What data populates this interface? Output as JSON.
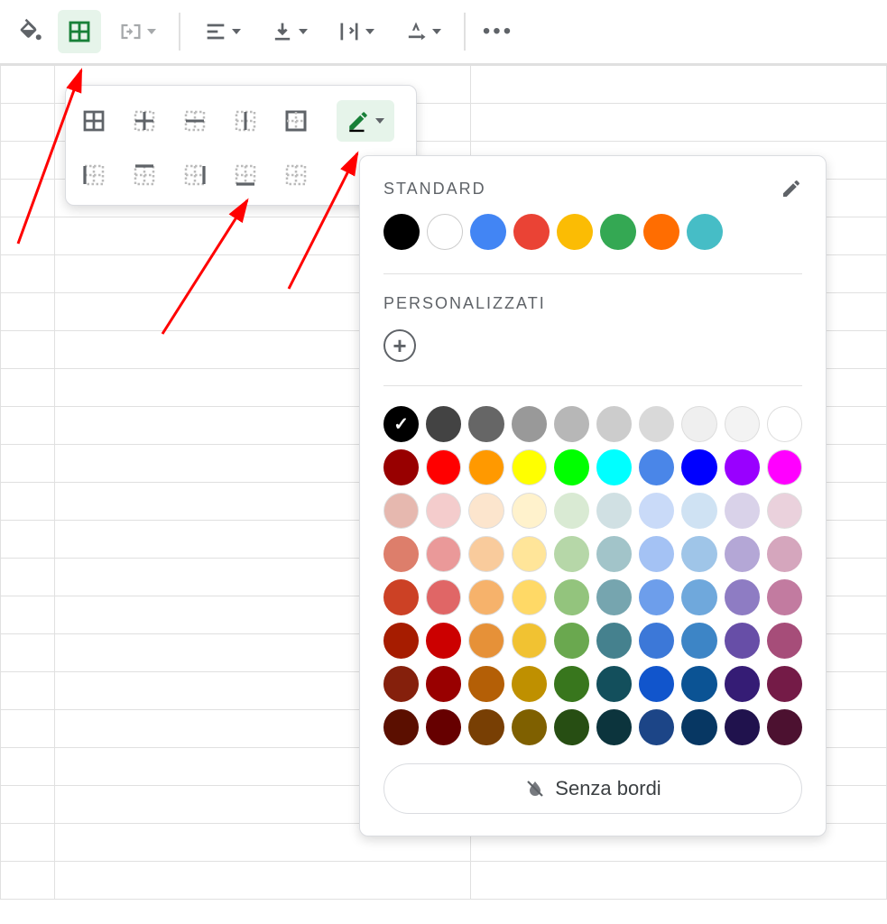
{
  "toolbar": {
    "items": [
      "fill-color",
      "borders",
      "merge",
      "align",
      "valign",
      "wrap",
      "rotate",
      "more"
    ]
  },
  "border_popup": {
    "buttons_row1": [
      "border-all",
      "border-inner",
      "border-horizontal",
      "border-vertical",
      "border-outer"
    ],
    "buttons_row2": [
      "border-left",
      "border-top",
      "border-right",
      "border-bottom",
      "border-none"
    ],
    "pen": "border-color"
  },
  "color_picker": {
    "standard_label": "STANDARD",
    "custom_label": "PERSONALIZZATI",
    "no_border_label": "Senza bordi",
    "standard_colors": [
      "#000000",
      "#ffffff",
      "#4285f4",
      "#ea4335",
      "#fbbc04",
      "#34a853",
      "#ff6d01",
      "#46bdc6"
    ],
    "selected_palette_index": [
      0,
      0
    ],
    "palette": [
      [
        "#000000",
        "#434343",
        "#666666",
        "#999999",
        "#b7b7b7",
        "#cccccc",
        "#d9d9d9",
        "#efefef",
        "#f3f3f3",
        "#ffffff"
      ],
      [
        "#980000",
        "#ff0000",
        "#ff9900",
        "#ffff00",
        "#00ff00",
        "#00ffff",
        "#4a86e8",
        "#0000ff",
        "#9900ff",
        "#ff00ff"
      ],
      [
        "#e6b8af",
        "#f4cccc",
        "#fce5cd",
        "#fff2cc",
        "#d9ead3",
        "#d0e0e3",
        "#c9daf8",
        "#cfe2f3",
        "#d9d2e9",
        "#ead1dc"
      ],
      [
        "#dd7e6b",
        "#ea9999",
        "#f9cb9c",
        "#ffe599",
        "#b6d7a8",
        "#a2c4c9",
        "#a4c2f4",
        "#9fc5e8",
        "#b4a7d6",
        "#d5a6bd"
      ],
      [
        "#cc4125",
        "#e06666",
        "#f6b26b",
        "#ffd966",
        "#93c47d",
        "#76a5af",
        "#6d9eeb",
        "#6fa8dc",
        "#8e7cc3",
        "#c27ba0"
      ],
      [
        "#a61c00",
        "#cc0000",
        "#e69138",
        "#f1c232",
        "#6aa84f",
        "#45818e",
        "#3c78d8",
        "#3d85c6",
        "#674ea7",
        "#a64d79"
      ],
      [
        "#85200c",
        "#990000",
        "#b45f06",
        "#bf9000",
        "#38761d",
        "#134f5c",
        "#1155cc",
        "#0b5394",
        "#351c75",
        "#741b47"
      ],
      [
        "#5b0f00",
        "#660000",
        "#783f04",
        "#7f6000",
        "#274e13",
        "#0c343d",
        "#1c4587",
        "#073763",
        "#20124d",
        "#4c1130"
      ]
    ]
  }
}
